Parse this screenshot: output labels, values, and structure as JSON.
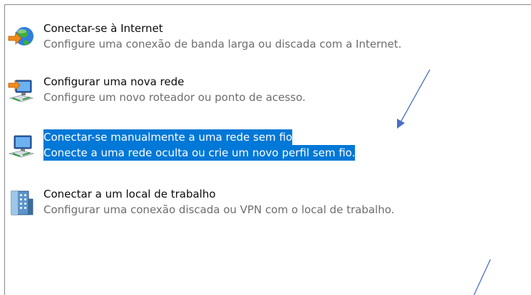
{
  "colors": {
    "selection": "#0078d7",
    "title_text": "#0a0a0a",
    "desc_text": "#6d6d6d",
    "annotation": "#4a6fc9"
  },
  "options": [
    {
      "title": "Conectar-se à Internet",
      "description": "Configure uma conexão de banda larga ou discada com a Internet.",
      "icon": "globe-network-icon",
      "selected": false
    },
    {
      "title": "Configurar uma nova rede",
      "description": "Configure um novo roteador ou ponto de acesso.",
      "icon": "new-network-router-icon",
      "selected": false
    },
    {
      "title": "Conectar-se manualmente a uma rede sem fio",
      "description": "Conecte a uma rede oculta ou crie um novo perfil sem fio.",
      "icon": "wireless-computer-icon",
      "selected": true
    },
    {
      "title": "Conectar a um local de trabalho",
      "description": "Configurar uma conexão discada ou VPN com o local de trabalho.",
      "icon": "workplace-building-icon",
      "selected": false
    }
  ]
}
